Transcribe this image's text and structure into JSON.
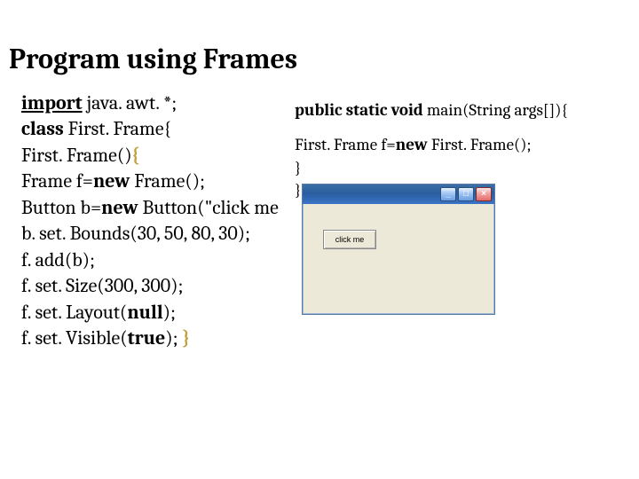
{
  "title": "Program using Frames",
  "left": {
    "l1_a": "import",
    "l1_b": " java. awt. *;",
    "l2_a": "class ",
    "l2_b": "First. Frame{",
    "l3_a": "First. Frame()",
    "l3_b": "{",
    "l4_a": "Frame f=",
    "l4_b": "new ",
    "l4_c": "Frame();",
    "l5_a": "Button b=",
    "l5_b": "new ",
    "l5_c": "Button(\"click me",
    "l6": "b. set. Bounds(30, 50, 80, 30);",
    "l7": "f. add(b);",
    "l8": "f. set. Size(300, 300);",
    "l9_a": "f. set. Layout(",
    "l9_b": "null",
    "l9_c": ");",
    "l10_a": "f. set. Visible(",
    "l10_b": "true",
    "l10_c": "); ",
    "l10_d": "}"
  },
  "right": {
    "r1_a": "public static void ",
    "r1_b": "main(String args[]){",
    "r2_a": "First. Frame f=",
    "r2_b": "new ",
    "r2_c": "First. Frame();",
    "r3": "}",
    "r4": "}"
  },
  "win": {
    "button_label": "click me",
    "min": "_",
    "max": "□",
    "close": "×"
  }
}
